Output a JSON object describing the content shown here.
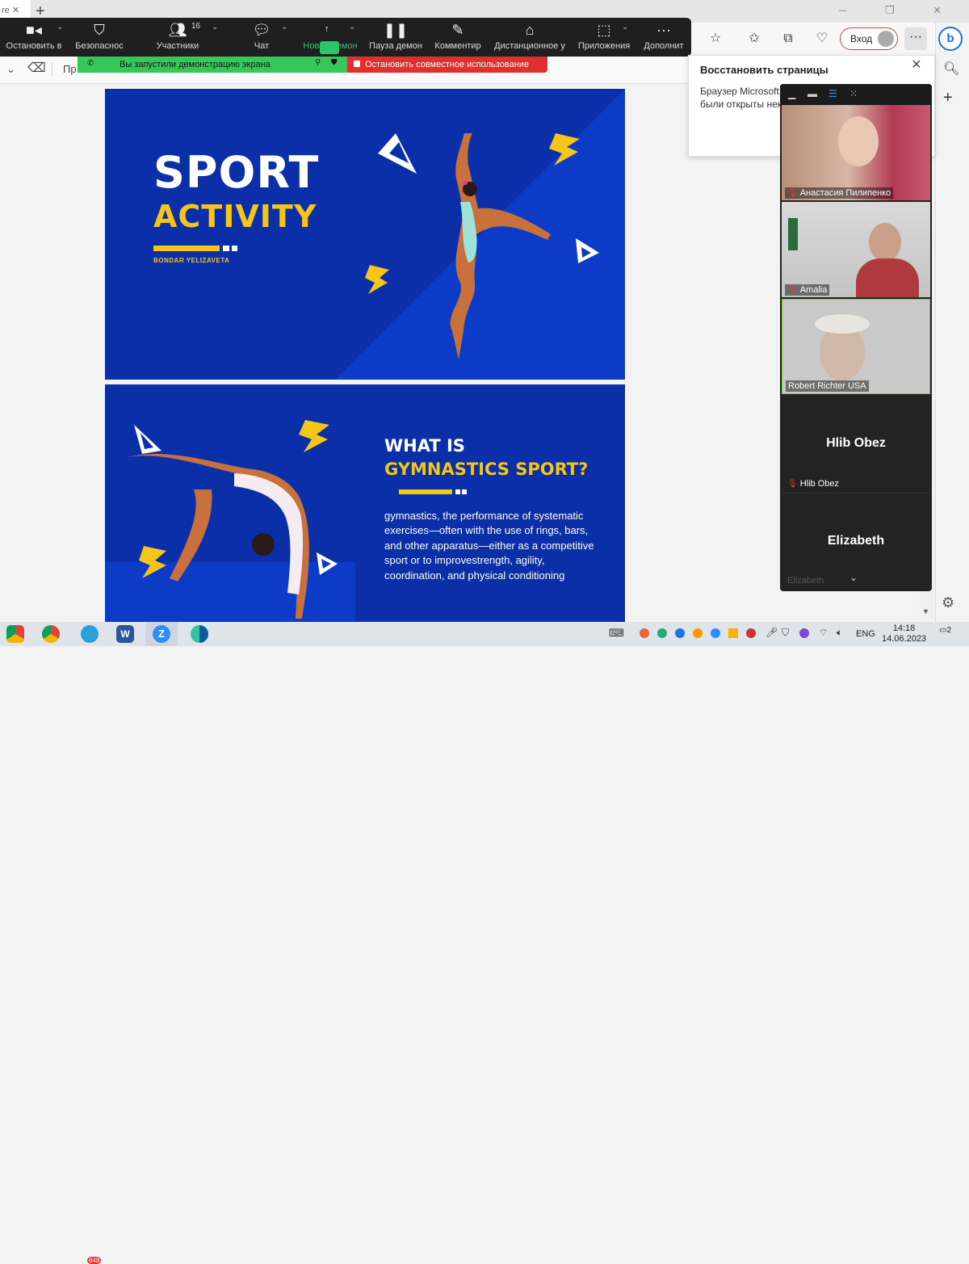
{
  "browser": {
    "tab_label": "re",
    "login_label": "Вход",
    "restore_title": "Восстановить страницы",
    "restore_body": "Браузер Microsoft были открыты нек"
  },
  "zoom_toolbar": {
    "buttons": [
      {
        "label": "Остановить в",
        "icon": "video-icon"
      },
      {
        "label": "Безопаснос",
        "icon": "shield-icon"
      },
      {
        "label": "Участники",
        "icon": "participants-icon",
        "count": "16"
      },
      {
        "label": "Чат",
        "icon": "chat-icon"
      },
      {
        "label": "Новая демон",
        "icon": "share-screen-icon",
        "active": true
      },
      {
        "label": "Пауза демон",
        "icon": "pause-icon"
      },
      {
        "label": "Комментир",
        "icon": "annotate-icon"
      },
      {
        "label": "Дистанционное у",
        "icon": "remote-control-icon"
      },
      {
        "label": "Приложения",
        "icon": "apps-icon"
      },
      {
        "label": "Дополнит",
        "icon": "more-icon"
      }
    ],
    "share_notice": "Вы запустили демонстрацию экрана",
    "stop_share": "Остановить совместное использование"
  },
  "doc_toolbar": {
    "partial_label": "Пр"
  },
  "slides": {
    "slide1": {
      "title_line1": "SPORT",
      "title_line2": "ACTIVITY",
      "author": "BONDAR YELIZAVETA"
    },
    "slide2": {
      "title_line1": "WHAT IS",
      "title_line2": "GYMNASTICS SPORT?",
      "body": "gymnastics, the performance of systematic exercises—often with the use of rings, bars, and other apparatus—either as a competitive sport or to improvestrength, agility, coordination, and physical conditioning"
    }
  },
  "participants": [
    {
      "name": "Анастасия Пилипенко",
      "muted": true,
      "video": true
    },
    {
      "name": "Amalia",
      "muted": true,
      "video": true
    },
    {
      "name": "Robert Richter USA",
      "muted": false,
      "video": true,
      "active_speaker": true
    },
    {
      "name": "Hlib Obez",
      "muted": true,
      "video": false
    },
    {
      "name": "Elizabeth",
      "muted": false,
      "video": false,
      "label": "Elizabeth"
    }
  ],
  "taskbar": {
    "telegram_badge": "848",
    "lang": "ENG",
    "time": "14:18",
    "date": "14.06.2023",
    "notifications": "2"
  },
  "colors": {
    "slide_bg": "#0a2fa8",
    "accent_yellow": "#f5c518",
    "zoom_green": "#2ac765",
    "stop_red": "#e0302e"
  }
}
